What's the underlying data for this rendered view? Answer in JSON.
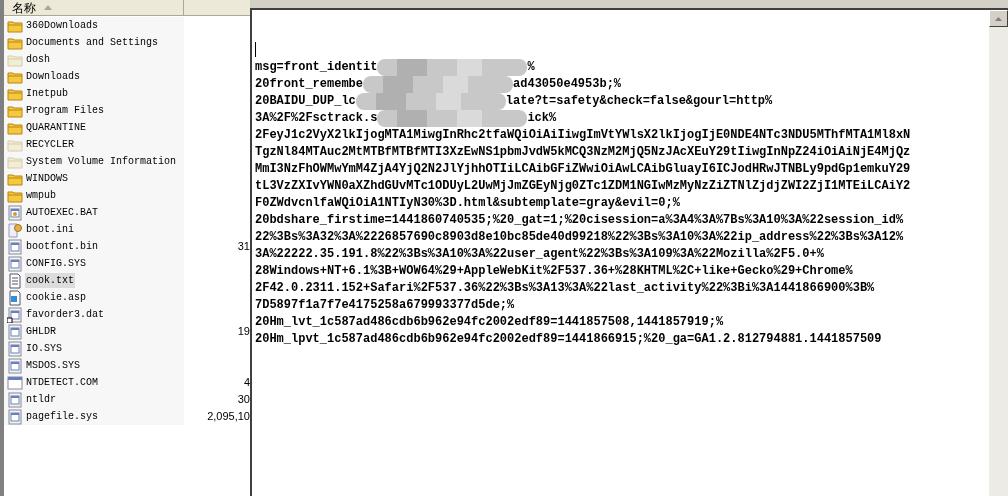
{
  "file_list": {
    "columns": [
      {
        "label": "名称",
        "sorted": true
      }
    ],
    "rows": [
      {
        "name": "360Downloads",
        "kind": "folder",
        "hidden": false,
        "selected": false
      },
      {
        "name": "Documents and Settings",
        "kind": "folder",
        "hidden": false,
        "selected": false
      },
      {
        "name": "dosh",
        "kind": "folder",
        "hidden": true,
        "selected": false
      },
      {
        "name": "Downloads",
        "kind": "folder",
        "hidden": false,
        "selected": false
      },
      {
        "name": "Inetpub",
        "kind": "folder",
        "hidden": false,
        "selected": false
      },
      {
        "name": "Program Files",
        "kind": "folder",
        "hidden": false,
        "selected": false
      },
      {
        "name": "QUARANTINE",
        "kind": "folder",
        "hidden": false,
        "selected": false
      },
      {
        "name": "RECYCLER",
        "kind": "folder",
        "hidden": true,
        "selected": false
      },
      {
        "name": "System Volume Information",
        "kind": "folder",
        "hidden": true,
        "selected": false
      },
      {
        "name": "WINDOWS",
        "kind": "folder",
        "hidden": false,
        "selected": false
      },
      {
        "name": "wmpub",
        "kind": "folder",
        "hidden": false,
        "selected": false
      },
      {
        "name": "AUTOEXEC.BAT",
        "kind": "batch",
        "selected": false
      },
      {
        "name": "boot.ini",
        "kind": "settings",
        "selected": false
      },
      {
        "name": "bootfont.bin",
        "kind": "system",
        "selected": false,
        "size": "31"
      },
      {
        "name": "CONFIG.SYS",
        "kind": "system",
        "selected": false
      },
      {
        "name": "cook.txt",
        "kind": "text",
        "selected": true
      },
      {
        "name": "cookie.asp",
        "kind": "script",
        "selected": false
      },
      {
        "name": "favorder3.dat",
        "kind": "shortcut",
        "selected": false
      },
      {
        "name": "GHLDR",
        "kind": "system",
        "selected": false,
        "size": "19"
      },
      {
        "name": "IO.SYS",
        "kind": "system",
        "selected": false
      },
      {
        "name": "MSDOS.SYS",
        "kind": "system",
        "selected": false
      },
      {
        "name": "NTDETECT.COM",
        "kind": "program",
        "selected": false,
        "size": "4"
      },
      {
        "name": "ntldr",
        "kind": "system",
        "selected": false,
        "size": "30"
      },
      {
        "name": "pagefile.sys",
        "kind": "system",
        "selected": false,
        "size": "2,095,10"
      }
    ]
  },
  "notepad": {
    "lines": [
      {
        "parts": [
          "msg=front_identit",
          "%"
        ]
      },
      {
        "parts": [
          "20front_remembe",
          "ad43050e4953b;%"
        ]
      },
      {
        "parts": [
          "20BAIDU_DUP_lc",
          "late?t=safety&check=false&gourl=http%"
        ]
      },
      {
        "parts": [
          "3A%2F%2Fsctrack.s",
          "ick%"
        ]
      },
      {
        "parts": [
          "2FeyJ1c2VyX2lkIjogMTA1MiwgInRhc2tfaWQiOiAiIiwgImVtYWlsX2lkIjogIjE0NDE4NTc3NDU5MThfMTA1Ml8xN"
        ]
      },
      {
        "parts": [
          "TgzNl84MTAuc2MtMTBfMTBfMTI3XzEwNS1pbmJvdW5kMCQ3NzM2MjQ5NzJAcXEuY29tIiwgInNpZ24iOiAiNjE4MjQz"
        ]
      },
      {
        "parts": [
          "MmI3NzFhOWMwYmM4ZjA4YjQ2N2JlYjhhOTIiLCAibGFiZWwiOiAwLCAibGluayI6ICJodHRwJTNBLy9pdGp1emkuY29"
        ]
      },
      {
        "parts": [
          "tL3VzZXIvYWN0aXZhdGUvMTc1ODUyL2UwMjJmZGEyNjg0ZTc1ZDM1NGIwMzMyNzZiZTNlZjdjZWI2ZjI1MTEiLCAiY2"
        ]
      },
      {
        "parts": [
          "F0ZWdvcnlfaWQiOiA1NTIyN30%3D.html&subtemplate=gray&evil=0;%"
        ]
      },
      {
        "parts": [
          "20bdshare_firstime=1441860740535;%20_gat=1;%20cisession=a%3A4%3A%7Bs%3A10%3A%22session_id%"
        ]
      },
      {
        "parts": [
          "22%3Bs%3A32%3A%2226857690c8903d8e10bc85de40d99218%22%3Bs%3A10%3A%22ip_address%22%3Bs%3A12%"
        ]
      },
      {
        "parts": [
          "3A%22222.35.191.8%22%3Bs%3A10%3A%22user_agent%22%3Bs%3A109%3A%22Mozilla%2F5.0+%"
        ]
      },
      {
        "parts": [
          "28Windows+NT+6.1%3B+WOW64%29+AppleWebKit%2F537.36+%28KHTML%2C+like+Gecko%29+Chrome%"
        ]
      },
      {
        "parts": [
          "2F42.0.2311.152+Safari%2F537.36%22%3Bs%3A13%3A%22last_activity%22%3Bi%3A1441866900%3B%"
        ]
      },
      {
        "parts": [
          "7D5897f1a7f7e4175258a679993377d5de;%"
        ]
      },
      {
        "parts": [
          "20Hm_lvt_1c587ad486cdb6b962e94fc2002edf89=1441857508,1441857919;%"
        ]
      },
      {
        "parts": [
          "20Hm_lpvt_1c587ad486cdb6b962e94fc2002edf89=1441866915;%20_ga=GA1.2.812794881.1441857509"
        ]
      }
    ]
  }
}
